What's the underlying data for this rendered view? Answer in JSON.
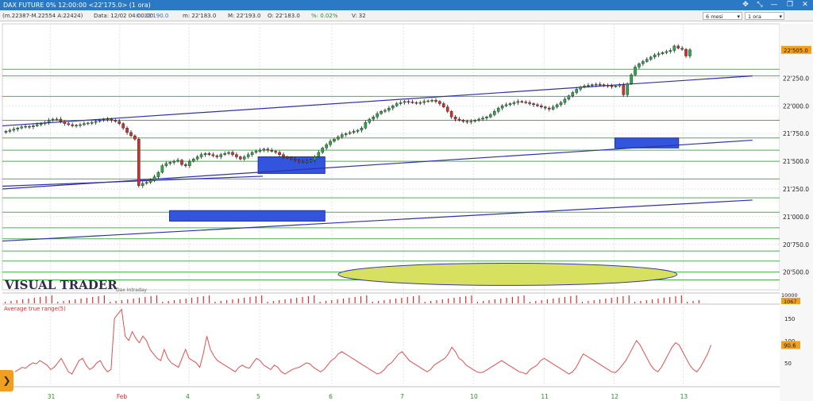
{
  "window": {
    "title": "DAX FUTURE 0%  12:00:00   <22'175.0>  (1 ora)",
    "pin_icon": "pin-icon",
    "collapse_icon": "collapse-icon",
    "restore_icon": "restore-icon",
    "close_icon": "close-icon"
  },
  "infobar": {
    "symbol": "(m.22387-M.22554 A:22424)",
    "date": "Data: 12/02 04:00:00",
    "close": "C: 22'190.0",
    "min": "m: 22'183.0",
    "max": "M: 22'193.0",
    "open": "O: 22'183.0",
    "pct": "%: 0.02%",
    "volume": "V: 32",
    "period_select": "6 mesi",
    "timeframe_select": "1 ora"
  },
  "colors": {
    "price_axis_highlight": "#f0a020",
    "atr_line": "#e05050",
    "support_lines": "#4caf50",
    "trend_lines": "#3030b0",
    "zones": "#3355dd",
    "ellipse": "#d8e060",
    "volume_bars": "#e03030"
  },
  "chart_data": [
    {
      "type": "candlestick",
      "title": "",
      "watermark": "VISUAL TRADER",
      "sub_label": "Dax Intraday",
      "x_ticks": [
        "31",
        "Feb",
        "4",
        "5",
        "6",
        "7",
        "10",
        "11",
        "12",
        "13"
      ],
      "y_ticks": [
        "22'250.0",
        "22'000.0",
        "21'750.0",
        "21'500.0",
        "21'250.0",
        "21'000.0",
        "20'750.0",
        "20'500.0"
      ],
      "ylim": [
        20340,
        22740
      ],
      "last_price_label": "22'505.0",
      "last_price": 22505,
      "close_series": [
        21770,
        21780,
        21790,
        21800,
        21810,
        21815,
        21810,
        21820,
        21830,
        21840,
        21850,
        21870,
        21880,
        21880,
        21860,
        21840,
        21830,
        21820,
        21825,
        21830,
        21840,
        21845,
        21850,
        21860,
        21870,
        21875,
        21880,
        21870,
        21860,
        21840,
        21800,
        21760,
        21730,
        21700,
        21280,
        21300,
        21310,
        21330,
        21360,
        21400,
        21460,
        21480,
        21490,
        21500,
        21510,
        21470,
        21460,
        21500,
        21520,
        21540,
        21560,
        21570,
        21560,
        21550,
        21540,
        21560,
        21570,
        21580,
        21560,
        21540,
        21520,
        21540,
        21560,
        21580,
        21590,
        21600,
        21610,
        21600,
        21590,
        21580,
        21560,
        21540,
        21530,
        21520,
        21510,
        21500,
        21490,
        21500,
        21510,
        21540,
        21580,
        21620,
        21650,
        21680,
        21700,
        21720,
        21740,
        21750,
        21760,
        21770,
        21780,
        21800,
        21850,
        21880,
        21900,
        21930,
        21950,
        21960,
        21980,
        22000,
        22020,
        22030,
        22040,
        22035,
        22030,
        22025,
        22030,
        22040,
        22045,
        22050,
        22040,
        22020,
        21990,
        21950,
        21900,
        21880,
        21870,
        21860,
        21855,
        21860,
        21870,
        21880,
        21890,
        21900,
        21920,
        21950,
        21980,
        22000,
        22010,
        22020,
        22030,
        22040,
        22035,
        22030,
        22020,
        22010,
        22000,
        21990,
        21980,
        21970,
        21990,
        22010,
        22030,
        22060,
        22090,
        22120,
        22150,
        22170,
        22180,
        22185,
        22190,
        22195,
        22190,
        22185,
        22180,
        22175,
        22180,
        22190,
        22100,
        22200,
        22280,
        22350,
        22380,
        22400,
        22420,
        22440,
        22460,
        22470,
        22480,
        22490,
        22500,
        22540,
        22520,
        22510,
        22450,
        22505
      ],
      "horizontal_levels": [
        22330,
        22270,
        22085,
        21870,
        21710,
        21600,
        21500,
        21340,
        21170,
        21040,
        20900,
        20800,
        20690,
        20600,
        20500,
        20430
      ],
      "trend_lines": [
        {
          "x1": 0.0,
          "y1": 21820,
          "x2": 0.965,
          "y2": 22270
        },
        {
          "x1": 0.0,
          "y1": 21250,
          "x2": 0.965,
          "y2": 21690
        },
        {
          "x1": 0.0,
          "y1": 21275,
          "x2": 0.335,
          "y2": 21365
        },
        {
          "x1": 0.0,
          "y1": 20780,
          "x2": 0.965,
          "y2": 21150
        }
      ],
      "zones": [
        {
          "x1": 0.329,
          "x2": 0.415,
          "y1": 21390,
          "y2": 21540
        },
        {
          "x1": 0.215,
          "x2": 0.415,
          "y1": 20960,
          "y2": 21055
        },
        {
          "x1": 0.788,
          "x2": 0.87,
          "y1": 21620,
          "y2": 21710
        }
      ],
      "ellipse": {
        "cx": 0.65,
        "cy": 20480,
        "rx": 0.218,
        "ry": 100
      }
    },
    {
      "type": "bar",
      "title": "",
      "name": "Volume",
      "y_ticks": [
        "10000"
      ],
      "last_value_label": "1067"
    },
    {
      "type": "line",
      "title": "Average true range(5)",
      "ylim": [
        0,
        180
      ],
      "y_ticks": [
        "150",
        "100",
        "50"
      ],
      "last_value_label": "90.6",
      "values": [
        30,
        35,
        40,
        38,
        45,
        50,
        48,
        55,
        50,
        45,
        35,
        40,
        50,
        60,
        45,
        30,
        25,
        40,
        55,
        60,
        45,
        35,
        40,
        50,
        55,
        40,
        30,
        35,
        150,
        160,
        170,
        110,
        100,
        120,
        105,
        95,
        110,
        100,
        80,
        70,
        60,
        55,
        80,
        60,
        50,
        45,
        40,
        60,
        80,
        60,
        55,
        50,
        40,
        70,
        110,
        80,
        65,
        55,
        50,
        45,
        40,
        35,
        30,
        40,
        45,
        40,
        38,
        50,
        60,
        55,
        45,
        40,
        35,
        45,
        40,
        30,
        25,
        30,
        35,
        38,
        40,
        45,
        50,
        48,
        40,
        35,
        30,
        35,
        45,
        55,
        60,
        70,
        75,
        70,
        65,
        60,
        55,
        50,
        45,
        40,
        35,
        30,
        25,
        28,
        35,
        45,
        50,
        60,
        70,
        75,
        65,
        55,
        50,
        45,
        40,
        35,
        30,
        35,
        45,
        50,
        55,
        60,
        70,
        85,
        75,
        60,
        55,
        45,
        40,
        35,
        30,
        28,
        30,
        35,
        40,
        45,
        50,
        55,
        50,
        45,
        40,
        35,
        30,
        28,
        25,
        35,
        40,
        45,
        55,
        60,
        55,
        50,
        45,
        40,
        35,
        30,
        25,
        30,
        40,
        55,
        70,
        65,
        60,
        55,
        50,
        45,
        40,
        35,
        30,
        28,
        35,
        45,
        55,
        70,
        85,
        100,
        90,
        75,
        60,
        45,
        35,
        30,
        40,
        55,
        70,
        85,
        95,
        90,
        75,
        60,
        45,
        35,
        30,
        40,
        55,
        70,
        90
      ]
    }
  ]
}
